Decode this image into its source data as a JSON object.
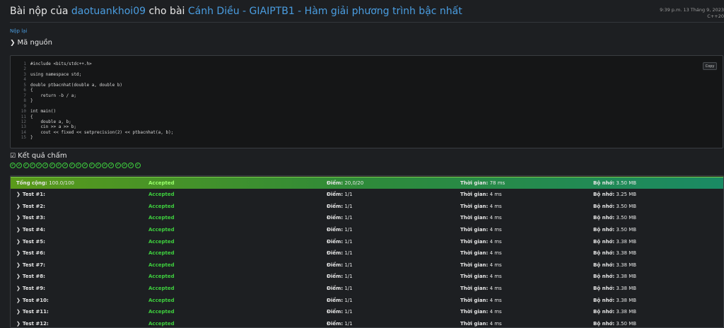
{
  "header": {
    "prefix": "Bài nộp của",
    "user": "daotuankhoi09",
    "mid": "cho bài",
    "problem": "Cánh Diều - GIAIPTB1 - Hàm giải phương trình bậc nhất",
    "datetime": "9:39 p.m. 13 Tháng 9, 2023",
    "language": "C++20"
  },
  "resubmit_label": "Nộp lại",
  "source_section": {
    "title": "Mã nguồn"
  },
  "copy_label": "Copy",
  "code_lines": [
    "#include <bits/stdc++.h>",
    "",
    "using namespace std;",
    "",
    "double ptbacnhat(double a, double b)",
    "{",
    "    return -b / a;",
    "}",
    "",
    "int main()",
    "{",
    "    double a, b;",
    "    cin >> a >> b;",
    "    cout << fixed << setprecision(2) << ptbacnhat(a, b);",
    "}"
  ],
  "results_section": {
    "title": "Kết quả chấm",
    "check_count": 20
  },
  "labels": {
    "score": "Điểm:",
    "time": "Thời gian:",
    "memory": "Bộ nhớ:"
  },
  "total": {
    "name": "Tổng cộng:",
    "value": "100.0/100",
    "status": "Accepted",
    "score": "20,0/20",
    "time": "78 ms",
    "memory": "3.50 MB"
  },
  "tests": [
    {
      "name": "Test #1:",
      "status": "Accepted",
      "score": "1/1",
      "time": "4 ms",
      "memory": "3.25 MB"
    },
    {
      "name": "Test #2:",
      "status": "Accepted",
      "score": "1/1",
      "time": "4 ms",
      "memory": "3.50 MB"
    },
    {
      "name": "Test #3:",
      "status": "Accepted",
      "score": "1/1",
      "time": "4 ms",
      "memory": "3.50 MB"
    },
    {
      "name": "Test #4:",
      "status": "Accepted",
      "score": "1/1",
      "time": "4 ms",
      "memory": "3.50 MB"
    },
    {
      "name": "Test #5:",
      "status": "Accepted",
      "score": "1/1",
      "time": "4 ms",
      "memory": "3.38 MB"
    },
    {
      "name": "Test #6:",
      "status": "Accepted",
      "score": "1/1",
      "time": "4 ms",
      "memory": "3.38 MB"
    },
    {
      "name": "Test #7:",
      "status": "Accepted",
      "score": "1/1",
      "time": "4 ms",
      "memory": "3.38 MB"
    },
    {
      "name": "Test #8:",
      "status": "Accepted",
      "score": "1/1",
      "time": "4 ms",
      "memory": "3.38 MB"
    },
    {
      "name": "Test #9:",
      "status": "Accepted",
      "score": "1/1",
      "time": "4 ms",
      "memory": "3.38 MB"
    },
    {
      "name": "Test #10:",
      "status": "Accepted",
      "score": "1/1",
      "time": "4 ms",
      "memory": "3.38 MB"
    },
    {
      "name": "Test #11:",
      "status": "Accepted",
      "score": "1/1",
      "time": "4 ms",
      "memory": "3.38 MB"
    },
    {
      "name": "Test #12:",
      "status": "Accepted",
      "score": "1/1",
      "time": "4 ms",
      "memory": "3.50 MB"
    }
  ]
}
